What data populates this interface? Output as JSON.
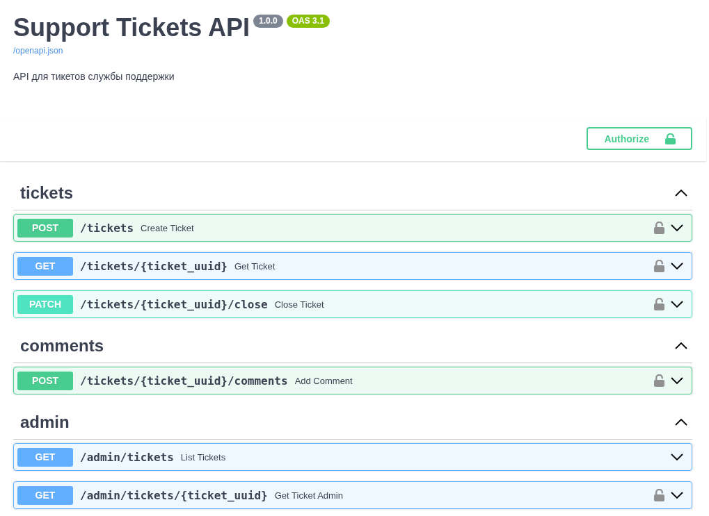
{
  "header": {
    "title": "Support Tickets API",
    "version": "1.0.0",
    "oas": "OAS 3.1",
    "spec_link": "/openapi.json",
    "description": "API для тикетов службы поддержки"
  },
  "authorize": {
    "label": "Authorize"
  },
  "tags": [
    {
      "name": "tickets",
      "expanded": true,
      "operations": [
        {
          "method": "POST",
          "color": "#49cc90",
          "path": "/tickets",
          "summary": "Create Ticket",
          "secured": true
        },
        {
          "method": "GET",
          "color": "#61affe",
          "path": "/tickets/{ticket_uuid}",
          "summary": "Get Ticket",
          "secured": true
        },
        {
          "method": "PATCH",
          "color": "#50e3c2",
          "path": "/tickets/{ticket_uuid}/close",
          "summary": "Close Ticket",
          "secured": true
        }
      ]
    },
    {
      "name": "comments",
      "expanded": true,
      "operations": [
        {
          "method": "POST",
          "color": "#49cc90",
          "path": "/tickets/{ticket_uuid}/comments",
          "summary": "Add Comment",
          "secured": true
        }
      ]
    },
    {
      "name": "admin",
      "expanded": true,
      "operations": [
        {
          "method": "GET",
          "color": "#61affe",
          "path": "/admin/tickets",
          "summary": "List Tickets",
          "secured": false
        },
        {
          "method": "GET",
          "color": "#61affe",
          "path": "/admin/tickets/{ticket_uuid}",
          "summary": "Get Ticket Admin",
          "secured": true
        }
      ]
    }
  ]
}
